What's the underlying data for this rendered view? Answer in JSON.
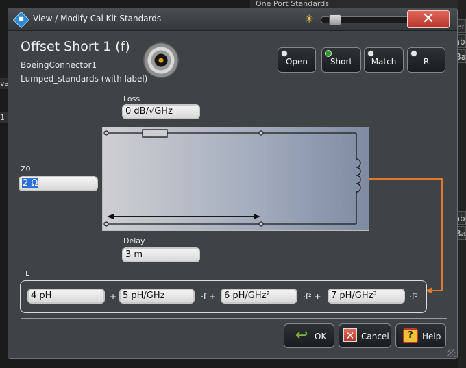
{
  "background": {
    "top_panel_title": "One Port Standards",
    "right_fragments": [
      "Gen",
      "Labe",
      "eBa",
      "Labe",
      "eBa"
    ],
    "left_fragments": [
      "val",
      "1"
    ]
  },
  "titlebar": {
    "title": "View / Modify Cal Kit Standards",
    "close_label": "✕",
    "brightness_level": 0.1
  },
  "standard": {
    "title": "Offset Short 1 (f)",
    "connector": "BoeingConnector1",
    "kit": "Lumped_standards (with label)"
  },
  "standard_buttons": [
    {
      "label": "Open",
      "active": false
    },
    {
      "label": "Short",
      "active": true
    },
    {
      "label": "Match",
      "active": false
    },
    {
      "label": "R",
      "active": false
    }
  ],
  "loss": {
    "label": "Loss",
    "value": "0 dB/√GHz"
  },
  "z0": {
    "label": "Z0",
    "value": "2 Ω"
  },
  "delay": {
    "label": "Delay",
    "value": "3 m"
  },
  "inductance": {
    "label": "L",
    "terms": [
      "4 pH",
      "5 pH/GHz",
      "6 pH/GHz²",
      "7 pH/GHz³"
    ],
    "ops": [
      "+",
      "·f +",
      "·f² +",
      "·f³"
    ]
  },
  "buttons": {
    "ok": "OK",
    "cancel": "Cancel",
    "help": "Help"
  },
  "colors": {
    "dialog_bg": "#3f4346",
    "arrow": "#e07a2e",
    "selection": "#2f6fd6",
    "close": "#c0392b"
  }
}
